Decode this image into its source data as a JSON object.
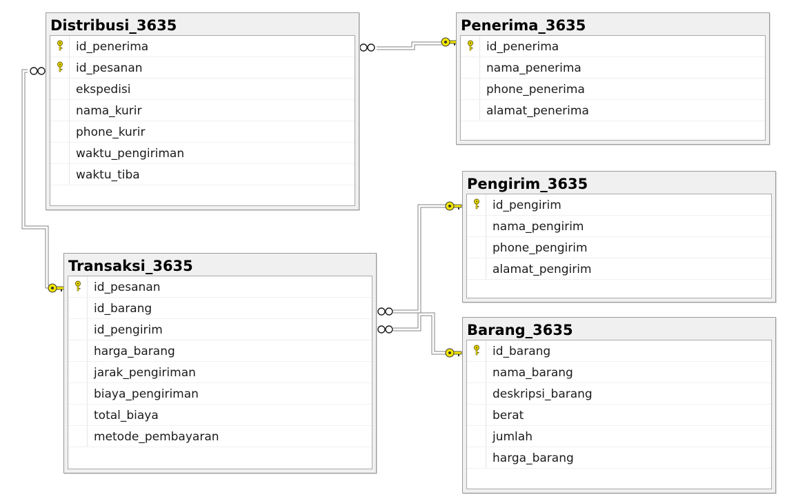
{
  "tables": {
    "distribusi": {
      "title": "Distribusi_3635",
      "columns": [
        {
          "name": "id_penerima",
          "pk": true
        },
        {
          "name": "id_pesanan",
          "pk": true
        },
        {
          "name": "ekspedisi",
          "pk": false
        },
        {
          "name": "nama_kurir",
          "pk": false
        },
        {
          "name": "phone_kurir",
          "pk": false
        },
        {
          "name": "waktu_pengiriman",
          "pk": false
        },
        {
          "name": "waktu_tiba",
          "pk": false
        }
      ]
    },
    "penerima": {
      "title": "Penerima_3635",
      "columns": [
        {
          "name": "id_penerima",
          "pk": true
        },
        {
          "name": "nama_penerima",
          "pk": false
        },
        {
          "name": "phone_penerima",
          "pk": false
        },
        {
          "name": "alamat_penerima",
          "pk": false
        }
      ]
    },
    "pengirim": {
      "title": "Pengirim_3635",
      "columns": [
        {
          "name": "id_pengirim",
          "pk": true
        },
        {
          "name": "nama_pengirim",
          "pk": false
        },
        {
          "name": "phone_pengirim",
          "pk": false
        },
        {
          "name": "alamat_pengirim",
          "pk": false
        }
      ]
    },
    "transaksi": {
      "title": "Transaksi_3635",
      "columns": [
        {
          "name": "id_pesanan",
          "pk": true
        },
        {
          "name": "id_barang",
          "pk": false
        },
        {
          "name": "id_pengirim",
          "pk": false
        },
        {
          "name": "harga_barang",
          "pk": false
        },
        {
          "name": "jarak_pengiriman",
          "pk": false
        },
        {
          "name": "biaya_pengiriman",
          "pk": false
        },
        {
          "name": "total_biaya",
          "pk": false
        },
        {
          "name": "metode_pembayaran",
          "pk": false
        }
      ]
    },
    "barang": {
      "title": "Barang_3635",
      "columns": [
        {
          "name": "id_barang",
          "pk": true
        },
        {
          "name": "nama_barang",
          "pk": false
        },
        {
          "name": "deskripsi_barang",
          "pk": false
        },
        {
          "name": "berat",
          "pk": false
        },
        {
          "name": "jumlah",
          "pk": false
        },
        {
          "name": "harga_barang",
          "pk": false
        }
      ]
    }
  },
  "relationships": [
    {
      "from": "Distribusi_3635",
      "to": "Penerima_3635",
      "many_end": "infinity-icon",
      "one_end": "key-icon"
    },
    {
      "from": "Distribusi_3635",
      "to": "Transaksi_3635",
      "many_end": "infinity-icon",
      "one_end": "key-icon"
    },
    {
      "from": "Transaksi_3635",
      "to": "Pengirim_3635",
      "many_end": "infinity-icon",
      "one_end": "key-icon"
    },
    {
      "from": "Transaksi_3635",
      "to": "Barang_3635",
      "many_end": "infinity-icon",
      "one_end": "key-icon"
    }
  ],
  "colors": {
    "key": "#f2e600",
    "line": "#7a7a7a",
    "header_bg": "#f0f0f0"
  }
}
